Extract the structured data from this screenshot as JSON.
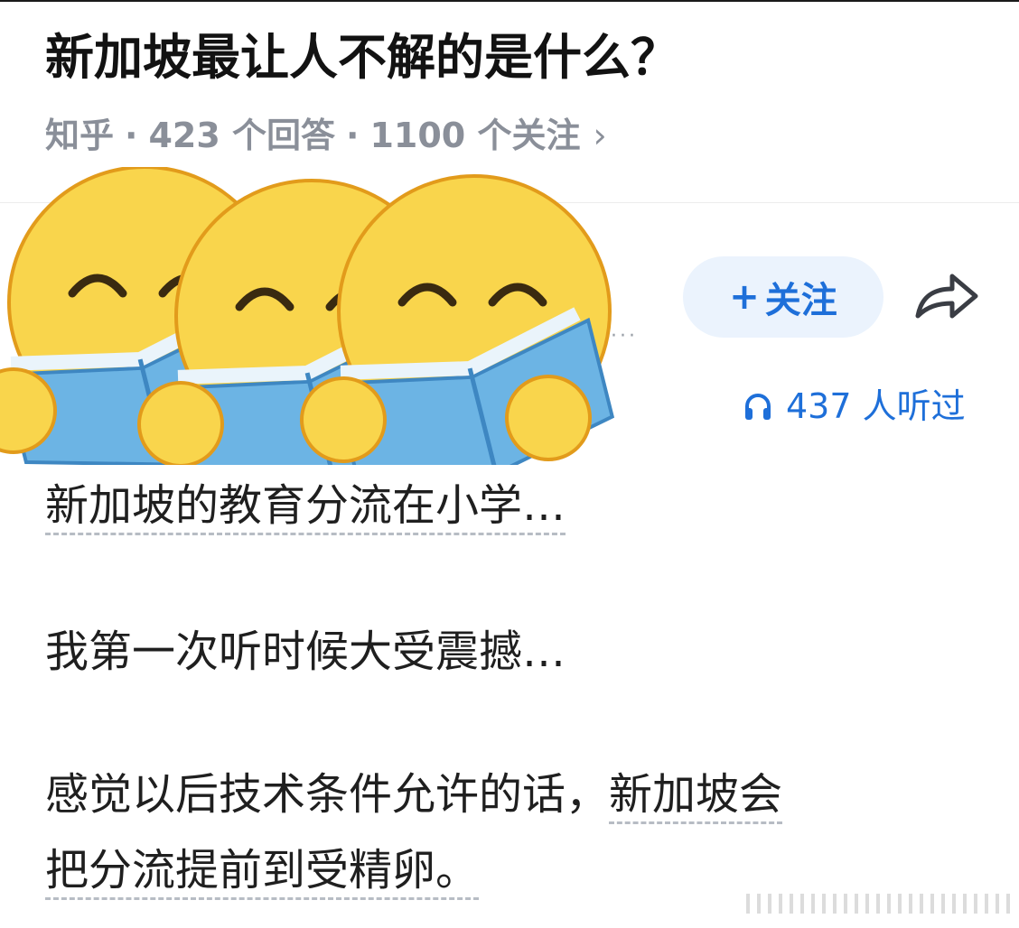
{
  "question": {
    "title": "新加坡最让人不解的是什么？",
    "source": "知乎",
    "answers": "423 个回答",
    "follows": "1100 个关注",
    "separator": "·",
    "chevron": "›"
  },
  "author": {
    "avatar": "reading-book-emoji-avatars",
    "more": "···",
    "follow_plus": "+",
    "follow_label": "关注",
    "share_icon": "share-arrow-icon"
  },
  "audio": {
    "icon": "headphones-icon",
    "listens": "437 人听过"
  },
  "answer": {
    "line1": "新加坡的教育分流在小学…",
    "line2": "我第一次听时候大受震撼…",
    "line3_plain": "感觉以后技术条件允许的话，",
    "line3_link": "新加坡会",
    "line4_link": "把分流提前到受精卵",
    "line4_end": "。"
  },
  "colors": {
    "accent": "#1e6fd9",
    "follow_bg": "#ebf3fd",
    "meta_gray": "#8a8f99"
  }
}
